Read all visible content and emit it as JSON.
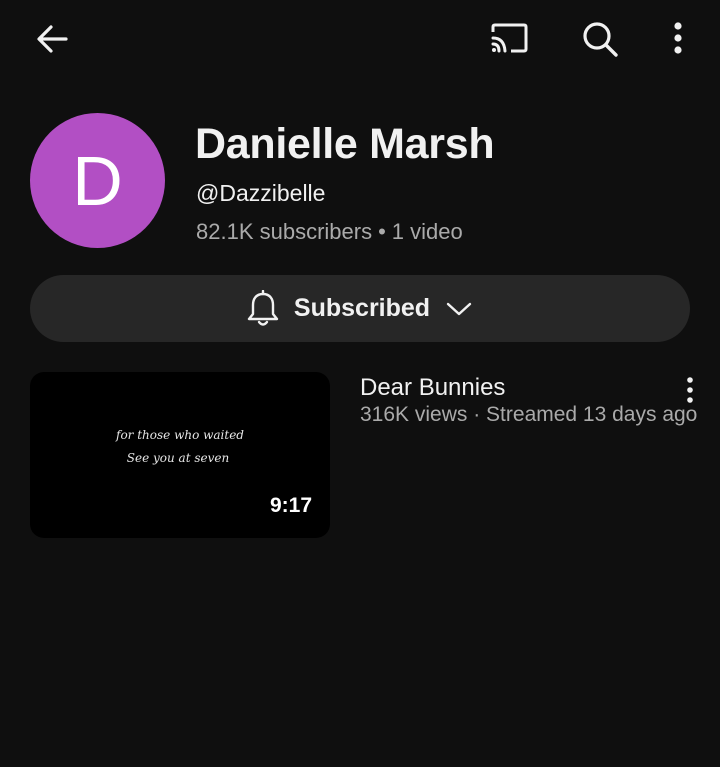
{
  "topbar": {
    "back_icon": "arrow-left-icon",
    "cast_icon": "cast-icon",
    "search_icon": "search-icon",
    "more_icon": "more-vertical-icon"
  },
  "channel": {
    "avatar_letter": "D",
    "avatar_color": "#b24fc4",
    "name": "Danielle Marsh",
    "handle": "@Dazzibelle",
    "subscribers": "82.1K subscribers",
    "separator": "•",
    "video_count": "1 video"
  },
  "subscribe": {
    "label": "Subscribed",
    "bell_icon": "bell-icon",
    "chevron_icon": "chevron-down-icon"
  },
  "videos": [
    {
      "title": "Dear Bunnies",
      "meta": "316K views · Streamed 13 days ago",
      "duration": "9:17",
      "thumb_line1": "for those who waited",
      "thumb_line2": "See you at seven"
    }
  ],
  "colors": {
    "background": "#0f0f0f",
    "pill": "#272727",
    "secondary_text": "#aaaaaa",
    "primary_text": "#f1f1f1"
  }
}
